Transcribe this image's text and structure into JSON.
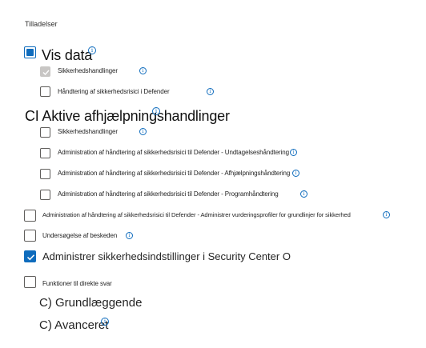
{
  "section_title": "Tilladelser",
  "view_data": {
    "label": "Vis data"
  },
  "view_items": [
    {
      "label": "Sikkerhedshandlinger"
    },
    {
      "label": "Håndtering af sikkerhedsrisici i Defender"
    }
  ],
  "active_remediation": {
    "label": "CI Aktive afhjælpningshandlinger"
  },
  "remediation_items": [
    {
      "label": "Sikkerhedshandlinger"
    },
    {
      "label": "Administration af håndtering af sikkerhedsrisici til Defender - Undtagelseshåndtering"
    },
    {
      "label": "Administration af håndtering af sikkerhedsrisici til Defender - Afhjælpningshåndtering"
    },
    {
      "label": "Administration af håndtering af sikkerhedsrisici til Defender - Programhåndtering"
    }
  ],
  "vuln_profiles": {
    "label": "Administration af håndtering af sikkerhedsrisici til Defender - Administrer vurderingsprofiler for grundlinjer for sikkerhed"
  },
  "investigate_messages": {
    "label": "Undersøgelse af beskeden"
  },
  "manage_security": {
    "label": "Administrer sikkerhedsindstillinger i Security Center O"
  },
  "live_response": {
    "label": "Funktioner til direkte svar"
  },
  "basic_option": {
    "label": "C) Grundlæggende"
  },
  "advanced_option": {
    "label": "C) Avanceret"
  },
  "colors": {
    "accent": "#0f6cbd",
    "disabled_check": "#c8c6c4"
  },
  "icons": {
    "info": "info-icon",
    "check": "checkmark-icon"
  }
}
